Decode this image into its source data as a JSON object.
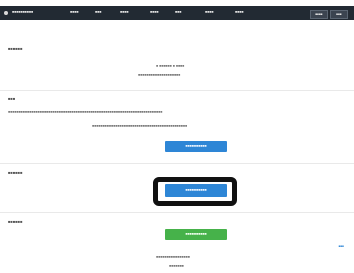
{
  "header": {
    "menu_items": [
      "■■■■■■■■■■",
      "■■■■",
      "■■■",
      "■■■■",
      "■■■■",
      "■■■",
      "■■■■",
      "■■■■"
    ],
    "right_btn_1": "■■■■",
    "right_btn_2": "■■■"
  },
  "sections": {
    "section_1": {
      "label": "■■■■■■",
      "line_1": "■ ■■■■■■  ■ ■■■■",
      "line_2": "■■■■■■■■■■■■■■■■■■■■"
    },
    "section_2": {
      "label": "■■■",
      "paragraph_1": "■■■■■■■■■■■■■■■■■■■■■■■■■■■■■■■■■■■■■■■■■■■■■■■■■■■■■■■■■■■■■■■■■■■■■■■■■",
      "paragraph_2": "■■■■■■■■■■■■■■■■■■■■■■■■■■■■■■■■■■■■■■■■■■■■■",
      "button_label": "■■■■■■■■■■"
    },
    "section_3": {
      "label": "■■■■■■",
      "button_label": "■■■■■■■■■■"
    },
    "section_4": {
      "label": "■■■■■■",
      "button_label": "■■■■■■■■■■",
      "footer_text": "■■■■■■■■■■■■■■■■",
      "footer_sub": "■■■■■■■",
      "side_link": "■■■"
    }
  }
}
